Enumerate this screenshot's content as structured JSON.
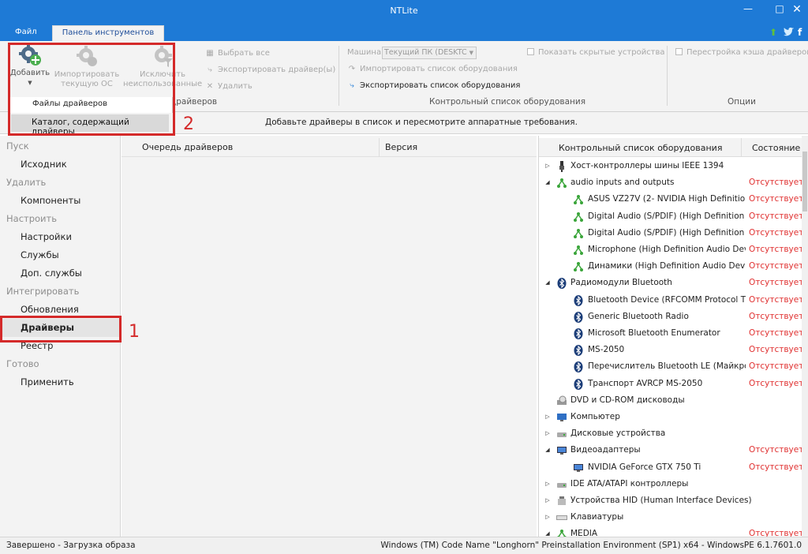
{
  "window": {
    "title": "NTLite",
    "controls": [
      "minimize-icon",
      "maximize-icon",
      "close-icon"
    ]
  },
  "tabs": [
    {
      "label": "Файл",
      "active": false
    },
    {
      "label": "Панель инструментов",
      "active": true
    }
  ],
  "tab_icons": [
    "up-arrow-icon",
    "twitter-icon",
    "facebook-icon"
  ],
  "ribbon": {
    "add": {
      "label": "Добавить",
      "arrow": "▼"
    },
    "import_os": {
      "line1": "Импортировать",
      "line2": "текущую ОС"
    },
    "exclude": {
      "line1": "Исключить",
      "line2": "неиспользованные",
      "arrow": "▼"
    },
    "select_all": "Выбрать все",
    "export_drivers": "Экспортировать драйвер(ы)",
    "delete": "Удалить",
    "drivers_group": "драйверов",
    "machine_label": "Машина",
    "machine_value": "Текущий ПК (DESKTC",
    "import_hw": "Импортировать список оборудования",
    "export_hw": "Экспортировать список оборудования",
    "hw_group": "Контрольный список оборудования",
    "show_hidden": "Показать скрытые устройства",
    "rebuild_cache": "Перестройка кэша драйверов",
    "options_group": "Опции"
  },
  "add_menu": {
    "driver_files": "Файлы драйверов",
    "catalog": "Каталог, содержащий драйверы"
  },
  "info_message": "Добавьте драйверы в список и пересмотрите аппаратные требования.",
  "annotations": {
    "one": "1",
    "two": "2"
  },
  "sidebar": [
    {
      "label": "Пуск",
      "kind": "header"
    },
    {
      "label": "Исходник",
      "kind": "item"
    },
    {
      "label": "Удалить",
      "kind": "header"
    },
    {
      "label": "Компоненты",
      "kind": "item"
    },
    {
      "label": "Настроить",
      "kind": "header"
    },
    {
      "label": "Настройки",
      "kind": "item"
    },
    {
      "label": "Службы",
      "kind": "item"
    },
    {
      "label": "Доп. службы",
      "kind": "item"
    },
    {
      "label": "Интегрировать",
      "kind": "header"
    },
    {
      "label": "Обновления",
      "kind": "item"
    },
    {
      "label": "Драйверы",
      "kind": "item",
      "selected": true
    },
    {
      "label": "Реестр",
      "kind": "item"
    },
    {
      "label": "Готово",
      "kind": "header"
    },
    {
      "label": "Применить",
      "kind": "item"
    }
  ],
  "queue": {
    "col_queue": "Очередь драйверов",
    "col_version": "Версия"
  },
  "hardware": {
    "col_list": "Контрольный список оборудования",
    "col_state": "Состояние",
    "rows": [
      {
        "label": "Хост-контроллеры шины IEEE 1394",
        "level": 0,
        "expand": "closed",
        "icon": "usb-plug-icon",
        "status": ""
      },
      {
        "label": "audio inputs and outputs",
        "level": 0,
        "expand": "open",
        "icon": "audio-icon",
        "status": "Отсутствует"
      },
      {
        "label": "ASUS VZ27V (2- NVIDIA High Definitio...",
        "level": 1,
        "expand": "",
        "icon": "audio-icon",
        "status": "Отсутствует"
      },
      {
        "label": "Digital Audio (S/PDIF) (High Definition A...",
        "level": 1,
        "expand": "",
        "icon": "audio-icon",
        "status": "Отсутствует"
      },
      {
        "label": "Digital Audio (S/PDIF) (High Definition A...",
        "level": 1,
        "expand": "",
        "icon": "audio-icon",
        "status": "Отсутствует"
      },
      {
        "label": "Microphone (High Definition Audio Devi...",
        "level": 1,
        "expand": "",
        "icon": "audio-icon",
        "status": "Отсутствует"
      },
      {
        "label": "Динамики (High Definition Audio Device)",
        "level": 1,
        "expand": "",
        "icon": "audio-icon",
        "status": "Отсутствует"
      },
      {
        "label": "Радиомодули Bluetooth",
        "level": 0,
        "expand": "open",
        "icon": "bluetooth-icon",
        "status": "Отсутствует"
      },
      {
        "label": "Bluetooth Device (RFCOMM Protocol T...",
        "level": 1,
        "expand": "",
        "icon": "bluetooth-icon",
        "status": "Отсутствует"
      },
      {
        "label": "Generic Bluetooth Radio",
        "level": 1,
        "expand": "",
        "icon": "bluetooth-icon",
        "status": "Отсутствует"
      },
      {
        "label": "Microsoft Bluetooth Enumerator",
        "level": 1,
        "expand": "",
        "icon": "bluetooth-icon",
        "status": "Отсутствует"
      },
      {
        "label": "MS-2050",
        "level": 1,
        "expand": "",
        "icon": "bluetooth-icon",
        "status": "Отсутствует"
      },
      {
        "label": "Перечислитель Bluetooth LE (Майкро...",
        "level": 1,
        "expand": "",
        "icon": "bluetooth-icon",
        "status": "Отсутствует"
      },
      {
        "label": "Транспорт AVRCP MS-2050",
        "level": 1,
        "expand": "",
        "icon": "bluetooth-icon",
        "status": "Отсутствует"
      },
      {
        "label": "DVD и CD-ROM дисководы",
        "level": 0,
        "expand": "",
        "icon": "dvd-drive-icon",
        "status": ""
      },
      {
        "label": "Компьютер",
        "level": 0,
        "expand": "closed",
        "icon": "computer-icon",
        "status": ""
      },
      {
        "label": "Дисковые устройства",
        "level": 0,
        "expand": "closed",
        "icon": "disk-drive-icon",
        "status": ""
      },
      {
        "label": "Видеоадаптеры",
        "level": 0,
        "expand": "open",
        "icon": "monitor-icon",
        "status": "Отсутствует"
      },
      {
        "label": "NVIDIA GeForce GTX 750 Ti",
        "level": 1,
        "expand": "",
        "icon": "monitor-icon",
        "status": "Отсутствует"
      },
      {
        "label": "IDE ATA/ATAPI контроллеры",
        "level": 0,
        "expand": "closed",
        "icon": "disk-drive-icon",
        "status": ""
      },
      {
        "label": "Устройства HID (Human Interface Devices)",
        "level": 0,
        "expand": "closed",
        "icon": "hid-icon",
        "status": ""
      },
      {
        "label": "Клавиатуры",
        "level": 0,
        "expand": "closed",
        "icon": "keyboard-icon",
        "status": ""
      },
      {
        "label": "MEDIA",
        "level": 0,
        "expand": "open",
        "icon": "audio-icon",
        "status": "Отсутствует"
      }
    ]
  },
  "status": {
    "left": "Завершено - Загрузка образа",
    "right": "Windows (TM) Code Name \"Longhorn\" Preinstallation Environment (SP1) x64 - WindowsPE 6.1.7601.0"
  },
  "colors": {
    "accent": "#1e7ad6",
    "missing": "#e03030",
    "highlight": "#d42a2a"
  }
}
